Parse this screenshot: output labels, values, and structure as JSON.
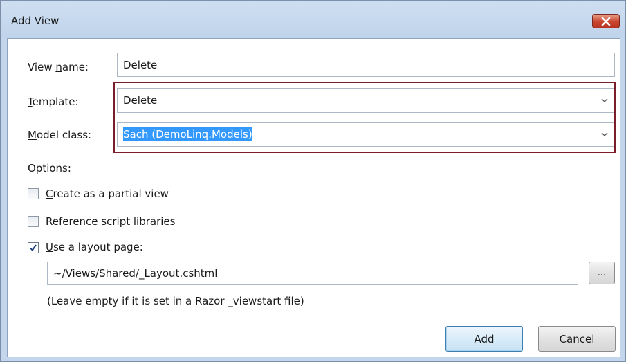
{
  "dialog": {
    "title": "Add View",
    "close_icon": "close-x-icon"
  },
  "form": {
    "view_name_label_before": "View ",
    "view_name_label_mnemonic": "n",
    "view_name_label_after": "ame:",
    "view_name_value": "Delete",
    "template_label_mnemonic": "T",
    "template_label_after": "emplate:",
    "template_value": "Delete",
    "model_class_label_mnemonic": "M",
    "model_class_label_after": "odel class:",
    "model_class_value": "Sach (DemoLinq.Models)",
    "chevron_icon": "chevron-down-icon"
  },
  "options": {
    "heading": "Options:",
    "partial_view_mnemonic": "C",
    "partial_view_rest": "reate as a partial view",
    "partial_view_checked": false,
    "script_libraries_mnemonic": "R",
    "script_libraries_rest": "eference script libraries",
    "script_libraries_checked": false,
    "layout_page_mnemonic": "U",
    "layout_page_rest": "se a layout page:",
    "layout_page_checked": true,
    "layout_path_value": "~/Views/Shared/_Layout.cshtml",
    "browse_label": "...",
    "layout_hint": "(Leave empty if it is set in a Razor _viewstart file)"
  },
  "buttons": {
    "add_label": "Add",
    "cancel_label": "Cancel"
  },
  "colors": {
    "highlight_border": "#7b1e2b",
    "selection": "#3399ff",
    "titlebar": "#c4d6ec"
  }
}
